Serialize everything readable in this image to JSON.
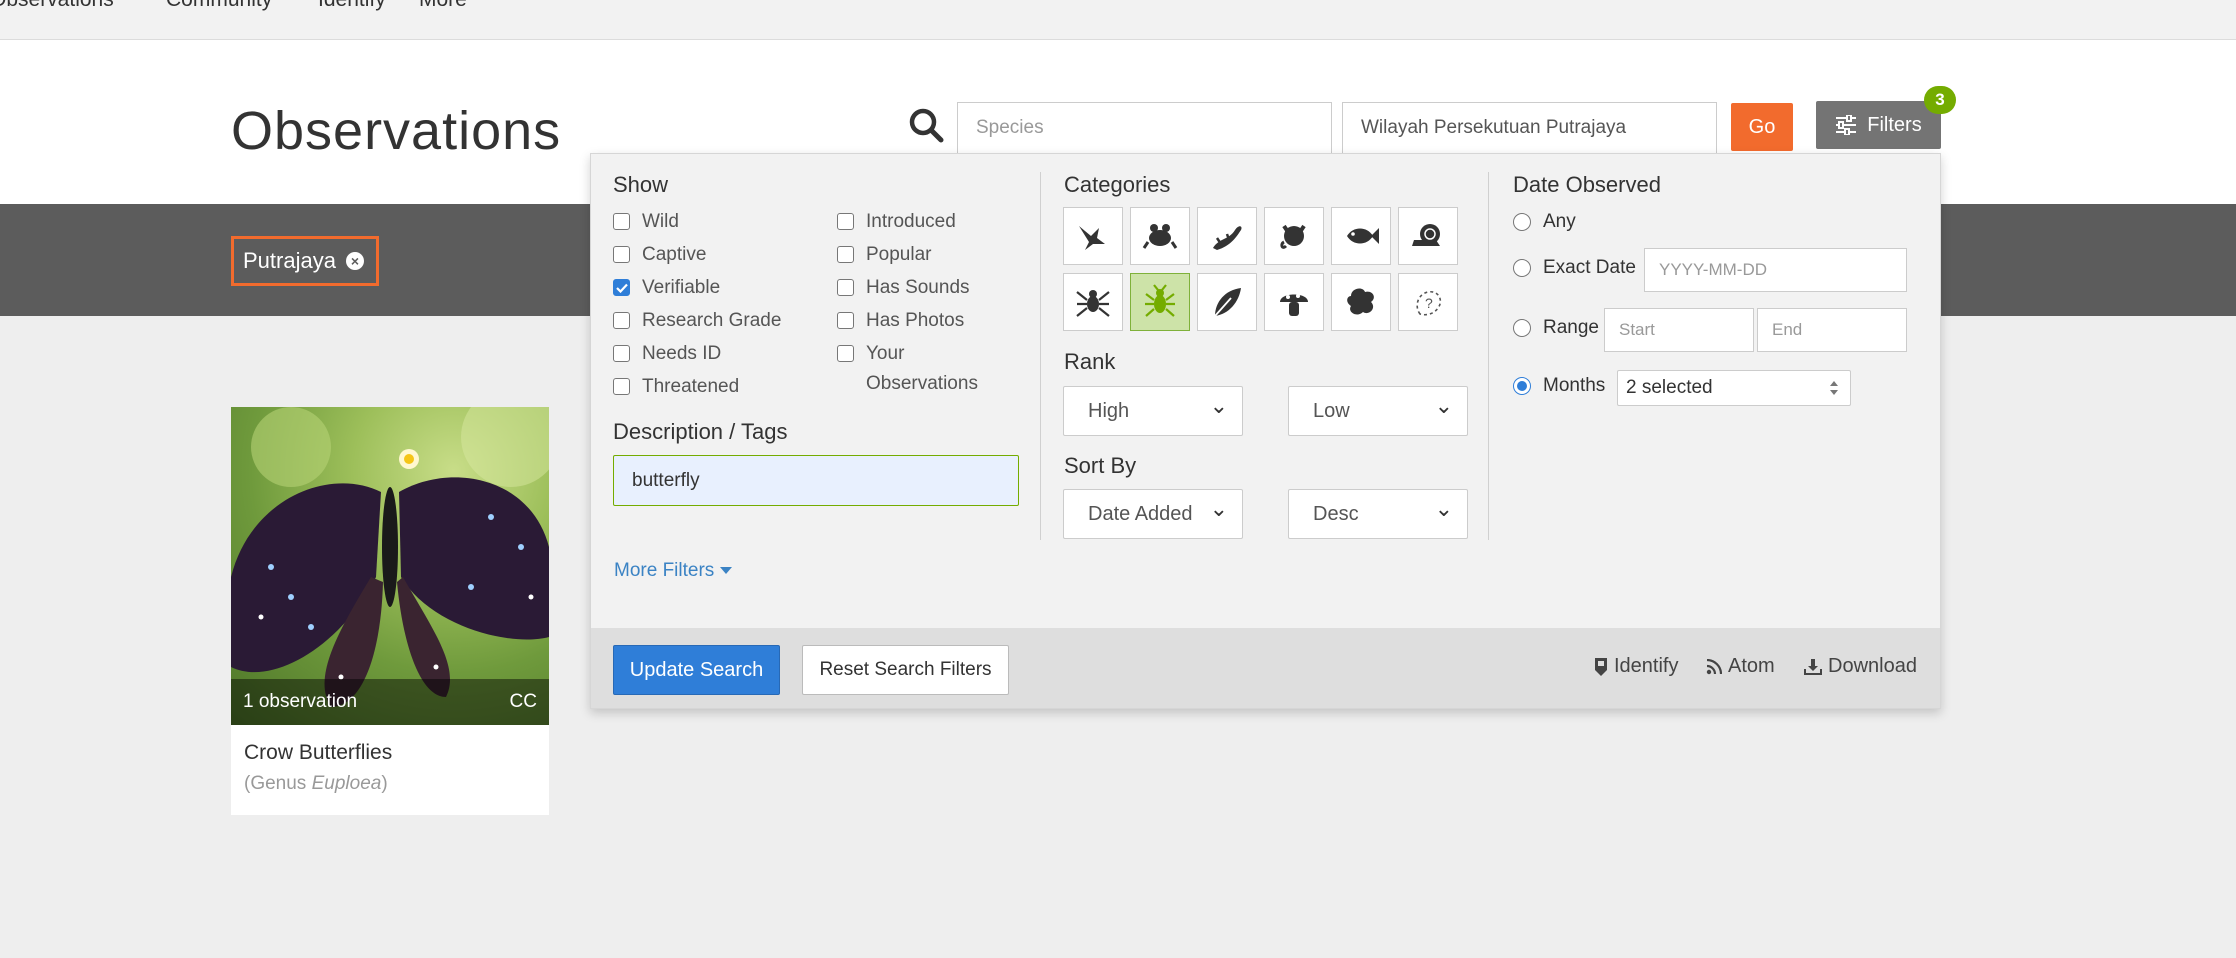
{
  "topnav": {
    "items": [
      "Observations",
      "Community",
      "Identify",
      "More"
    ]
  },
  "page": {
    "title": "Observations"
  },
  "search": {
    "species_placeholder": "Species",
    "place_value": "Wilayah Persekutuan Putrajaya",
    "go_label": "Go",
    "filters_label": "Filters",
    "filters_count": "3"
  },
  "place_chip": {
    "label": "Putrajaya"
  },
  "card": {
    "count_label": "1 observation",
    "license": "CC",
    "name": "Crow Butterflies",
    "rank_prefix": "(Genus ",
    "sci_name": "Euploea",
    "rank_suffix": ")"
  },
  "filters": {
    "show": {
      "title": "Show",
      "left": [
        {
          "label": "Wild",
          "checked": false
        },
        {
          "label": "Captive",
          "checked": false
        },
        {
          "label": "Verifiable",
          "checked": true
        },
        {
          "label": "Research Grade",
          "checked": false
        },
        {
          "label": "Needs ID",
          "checked": false
        },
        {
          "label": "Threatened",
          "checked": false
        }
      ],
      "right": [
        {
          "label": "Introduced",
          "checked": false
        },
        {
          "label": "Popular",
          "checked": false
        },
        {
          "label": "Has Sounds",
          "checked": false
        },
        {
          "label": "Has Photos",
          "checked": false
        },
        {
          "label": "Your Observations",
          "checked": false
        }
      ]
    },
    "description": {
      "title": "Description / Tags",
      "value": "butterfly"
    },
    "more_filters": "More Filters",
    "categories": {
      "title": "Categories",
      "items": [
        {
          "icon": "bird-icon",
          "selected": false
        },
        {
          "icon": "amphibian-icon",
          "selected": false
        },
        {
          "icon": "reptile-icon",
          "selected": false
        },
        {
          "icon": "mammal-icon",
          "selected": false
        },
        {
          "icon": "fish-icon",
          "selected": false
        },
        {
          "icon": "mollusk-icon",
          "selected": false
        },
        {
          "icon": "arachnid-icon",
          "selected": false
        },
        {
          "icon": "insect-icon",
          "selected": true
        },
        {
          "icon": "plant-icon",
          "selected": false
        },
        {
          "icon": "fungi-icon",
          "selected": false
        },
        {
          "icon": "protozoa-icon",
          "selected": false
        },
        {
          "icon": "unknown-icon",
          "selected": false
        }
      ]
    },
    "rank": {
      "title": "Rank",
      "high": "High",
      "low": "Low"
    },
    "sort": {
      "title": "Sort By",
      "by": "Date Added",
      "order": "Desc"
    },
    "date": {
      "title": "Date Observed",
      "any": "Any",
      "exact": "Exact Date",
      "exact_placeholder": "YYYY-MM-DD",
      "range": "Range",
      "start_placeholder": "Start",
      "end_placeholder": "End",
      "months": "Months",
      "months_value": "2 selected",
      "selected": "months"
    },
    "footer": {
      "update": "Update Search",
      "reset": "Reset Search Filters",
      "identify": "Identify",
      "atom": "Atom",
      "download": "Download"
    }
  },
  "colors": {
    "accent": "#f26b2d",
    "primary": "#2f7ed8",
    "green": "#74ac00",
    "selected_tile": "#cde3a8"
  }
}
